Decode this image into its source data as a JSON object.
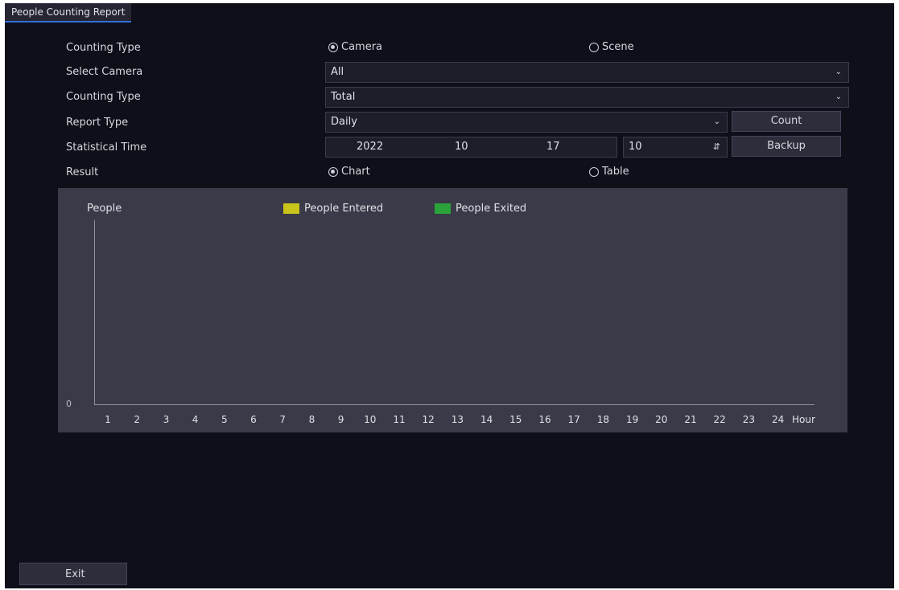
{
  "window": {
    "tab_title": "People Counting Report"
  },
  "form": {
    "counting_type_label": "Counting Type",
    "counting_type_options": [
      "Camera",
      "Scene"
    ],
    "select_camera_label": "Select Camera",
    "select_camera_value": "All",
    "counting_type2_label": "Counting Type",
    "counting_type2_value": "Total",
    "report_type_label": "Report Type",
    "report_type_value": "Daily",
    "statistical_time_label": "Statistical Time",
    "date": {
      "year": "2022",
      "month": "10",
      "day": "17"
    },
    "hour_value": "10",
    "result_label": "Result",
    "result_options": [
      "Chart",
      "Table"
    ],
    "count_button": "Count",
    "backup_button": "Backup"
  },
  "chart_data": {
    "type": "bar",
    "ylabel": "People",
    "xlabel": "Hour",
    "y_min_label": "0",
    "categories": [
      "1",
      "2",
      "3",
      "4",
      "5",
      "6",
      "7",
      "8",
      "9",
      "10",
      "11",
      "12",
      "13",
      "14",
      "15",
      "16",
      "17",
      "18",
      "19",
      "20",
      "21",
      "22",
      "23",
      "24"
    ],
    "series": [
      {
        "name": "People Entered",
        "color": "#c8c41a",
        "values": []
      },
      {
        "name": "People Exited",
        "color": "#2aa33a",
        "values": []
      }
    ],
    "grid": false,
    "legend": "top"
  },
  "footer": {
    "exit_button": "Exit"
  },
  "icons": {
    "dropdown": "chevron-down-icon",
    "spinner": "up-down-spinner-icon"
  }
}
